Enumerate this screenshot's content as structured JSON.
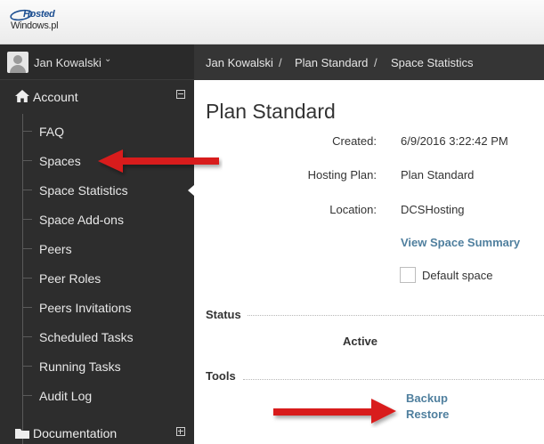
{
  "brand": {
    "line1": "Hosted",
    "line2": "Windows.pl"
  },
  "user": {
    "name": "Jan Kowalski"
  },
  "sidebar": {
    "account_label": "Account",
    "items": [
      {
        "label": "FAQ"
      },
      {
        "label": "Spaces"
      },
      {
        "label": "Space Statistics"
      },
      {
        "label": "Space Add-ons"
      },
      {
        "label": "Peers"
      },
      {
        "label": "Peer Roles"
      },
      {
        "label": "Peers Invitations"
      },
      {
        "label": "Scheduled Tasks"
      },
      {
        "label": "Running Tasks"
      },
      {
        "label": "Audit Log"
      }
    ],
    "documentation_label": "Documentation"
  },
  "breadcrumb": {
    "items": [
      "Jan Kowalski",
      "Plan Standard",
      "Space Statistics"
    ],
    "separator": "/"
  },
  "main": {
    "title": "Plan Standard",
    "fields": [
      {
        "label": "Created:",
        "value": "6/9/2016 3:22:42 PM"
      },
      {
        "label": "Hosting Plan:",
        "value": "Plan Standard"
      },
      {
        "label": "Location:",
        "value": "DCSHosting"
      }
    ],
    "view_summary_link": "View Space Summary",
    "default_space_label": "Default space",
    "default_space_checked": false,
    "status_heading": "Status",
    "status_value": "Active",
    "tools_heading": "Tools",
    "tools_links": [
      "Backup",
      "Restore"
    ]
  },
  "colors": {
    "sidebar_bg": "#2d2d2d",
    "crumb_bg": "#353535",
    "link": "#4f7f9e",
    "annotation": "#d81e1e"
  },
  "icons": [
    "home-icon",
    "folder-icon",
    "chevron-down-icon",
    "collapse-icon",
    "expand-icon"
  ]
}
